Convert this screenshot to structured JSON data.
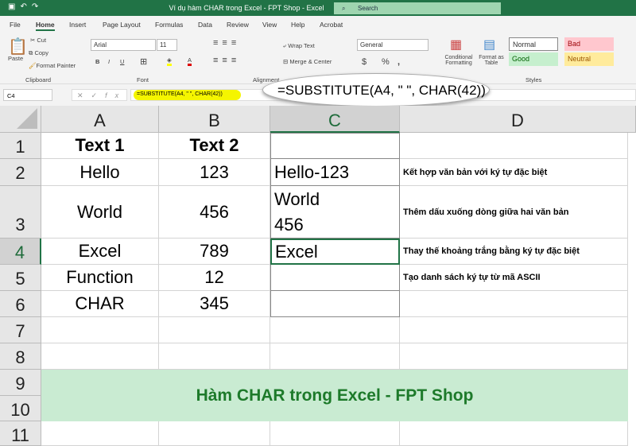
{
  "window": {
    "title": "Ví dụ hàm CHAR trong Excel - FPT Shop  -  Excel",
    "search": "Search"
  },
  "tabs": [
    "File",
    "Home",
    "Insert",
    "Page Layout",
    "Formulas",
    "Data",
    "Review",
    "View",
    "Help",
    "Acrobat"
  ],
  "ribbon": {
    "paste": "Paste",
    "cut": "Cut",
    "copy": "Copy",
    "format_painter": "Format Painter",
    "clipboard": "Clipboard",
    "font_name": "Arial",
    "font_size": "11",
    "font": "Font",
    "bold": "B",
    "italic": "I",
    "underline": "U",
    "wrap_text": "Wrap Text",
    "merge_center": "Merge & Center",
    "alignment": "Alignment",
    "number_format": "General",
    "currency": "$",
    "percent": "%",
    "comma": ",",
    "conditional_formatting": "Conditional Formatting",
    "format_as_table": "Format as Table",
    "styles": "Styles",
    "style_normal": "Normal",
    "style_bad": "Bad",
    "style_good": "Good",
    "style_neutral": "Neutral"
  },
  "formula_bar": {
    "name_box": "C4",
    "fx": "fx",
    "formula": "=SUBSTITUTE(A4, \" \", CHAR(42))",
    "callout": "=SUBSTITUTE(A4, \" \", CHAR(42))"
  },
  "columns": [
    "A",
    "B",
    "C",
    "D"
  ],
  "rows": [
    "1",
    "2",
    "3",
    "4",
    "5",
    "6",
    "7",
    "8",
    "9",
    "10",
    "11"
  ],
  "cells": {
    "A1": "Text 1",
    "B1": "Text 2",
    "A2": "Hello",
    "B2": "123",
    "C2": "Hello-123",
    "D2": "Kết hợp văn bản với ký tự đặc biệt",
    "A3": "World",
    "B3": "456",
    "C3a": "World",
    "C3b": "456",
    "D3": "Thêm dấu xuống dòng giữa hai văn bản",
    "A4": "Excel",
    "B4": "789",
    "C4": "Excel",
    "D4": "Thay thế khoảng trắng bằng ký tự đặc biệt",
    "A5": "Function",
    "B5": "12",
    "D5": "Tạo danh sách ký tự từ mã ASCII",
    "A6": "CHAR",
    "B6": "345"
  },
  "banner": "Hàm CHAR trong Excel - FPT Shop",
  "colors": {
    "excel_green": "#217346",
    "banner_bg": "#c9ebd2",
    "banner_text": "#1d7a2a",
    "highlight": "#f5f500"
  }
}
